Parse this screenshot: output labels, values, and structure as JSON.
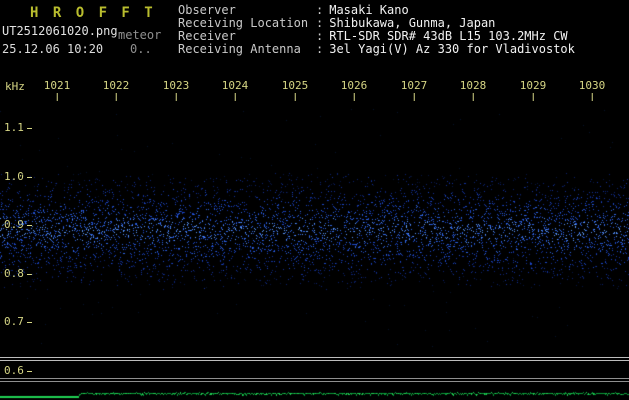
{
  "header": {
    "logo": "H R O F F T",
    "filename": "UT2512061020.png",
    "station": "meteor",
    "datetime": "25.12.06 10:20",
    "counter": "0..",
    "colon": ":",
    "info": [
      {
        "label": "Observer",
        "value": "Masaki Kano"
      },
      {
        "label": "Receiving Location",
        "value": "Shibukawa, Gunma, Japan"
      },
      {
        "label": "Receiver",
        "value": "RTL-SDR SDR# 43dB L15 103.2MHz CW"
      },
      {
        "label": "Receiving Antenna",
        "value": "3el Yagi(V) Az 330 for Vladivostok"
      }
    ]
  },
  "chart_data": {
    "type": "heatmap",
    "ylabel": "kHz",
    "x_ticks": [
      "1021",
      "1022",
      "1023",
      "1024",
      "1025",
      "1026",
      "1027",
      "1028",
      "1029",
      "1030"
    ],
    "y_ticks": [
      "1.1",
      "1.0",
      "0.9",
      "0.8",
      "0.7",
      "0.6"
    ],
    "ylim": [
      0.55,
      1.15
    ],
    "x_axis_meaning": "time UT hhmm from 10:21 to 10:30",
    "noise_band_khz": [
      0.78,
      1.0
    ],
    "noise_center_khz": 0.89,
    "signal": "diffuse blue background noise band only, no meteor echoes visible",
    "background": "#000000",
    "axis_color": "#d6d685",
    "dot_colors": [
      "#081543",
      "#0c2270",
      "#14339e",
      "#1e4acc",
      "#3068e8",
      "#5f9cff"
    ],
    "trace_color": "#0b9e3b",
    "trace_bright_color": "#21d455"
  }
}
